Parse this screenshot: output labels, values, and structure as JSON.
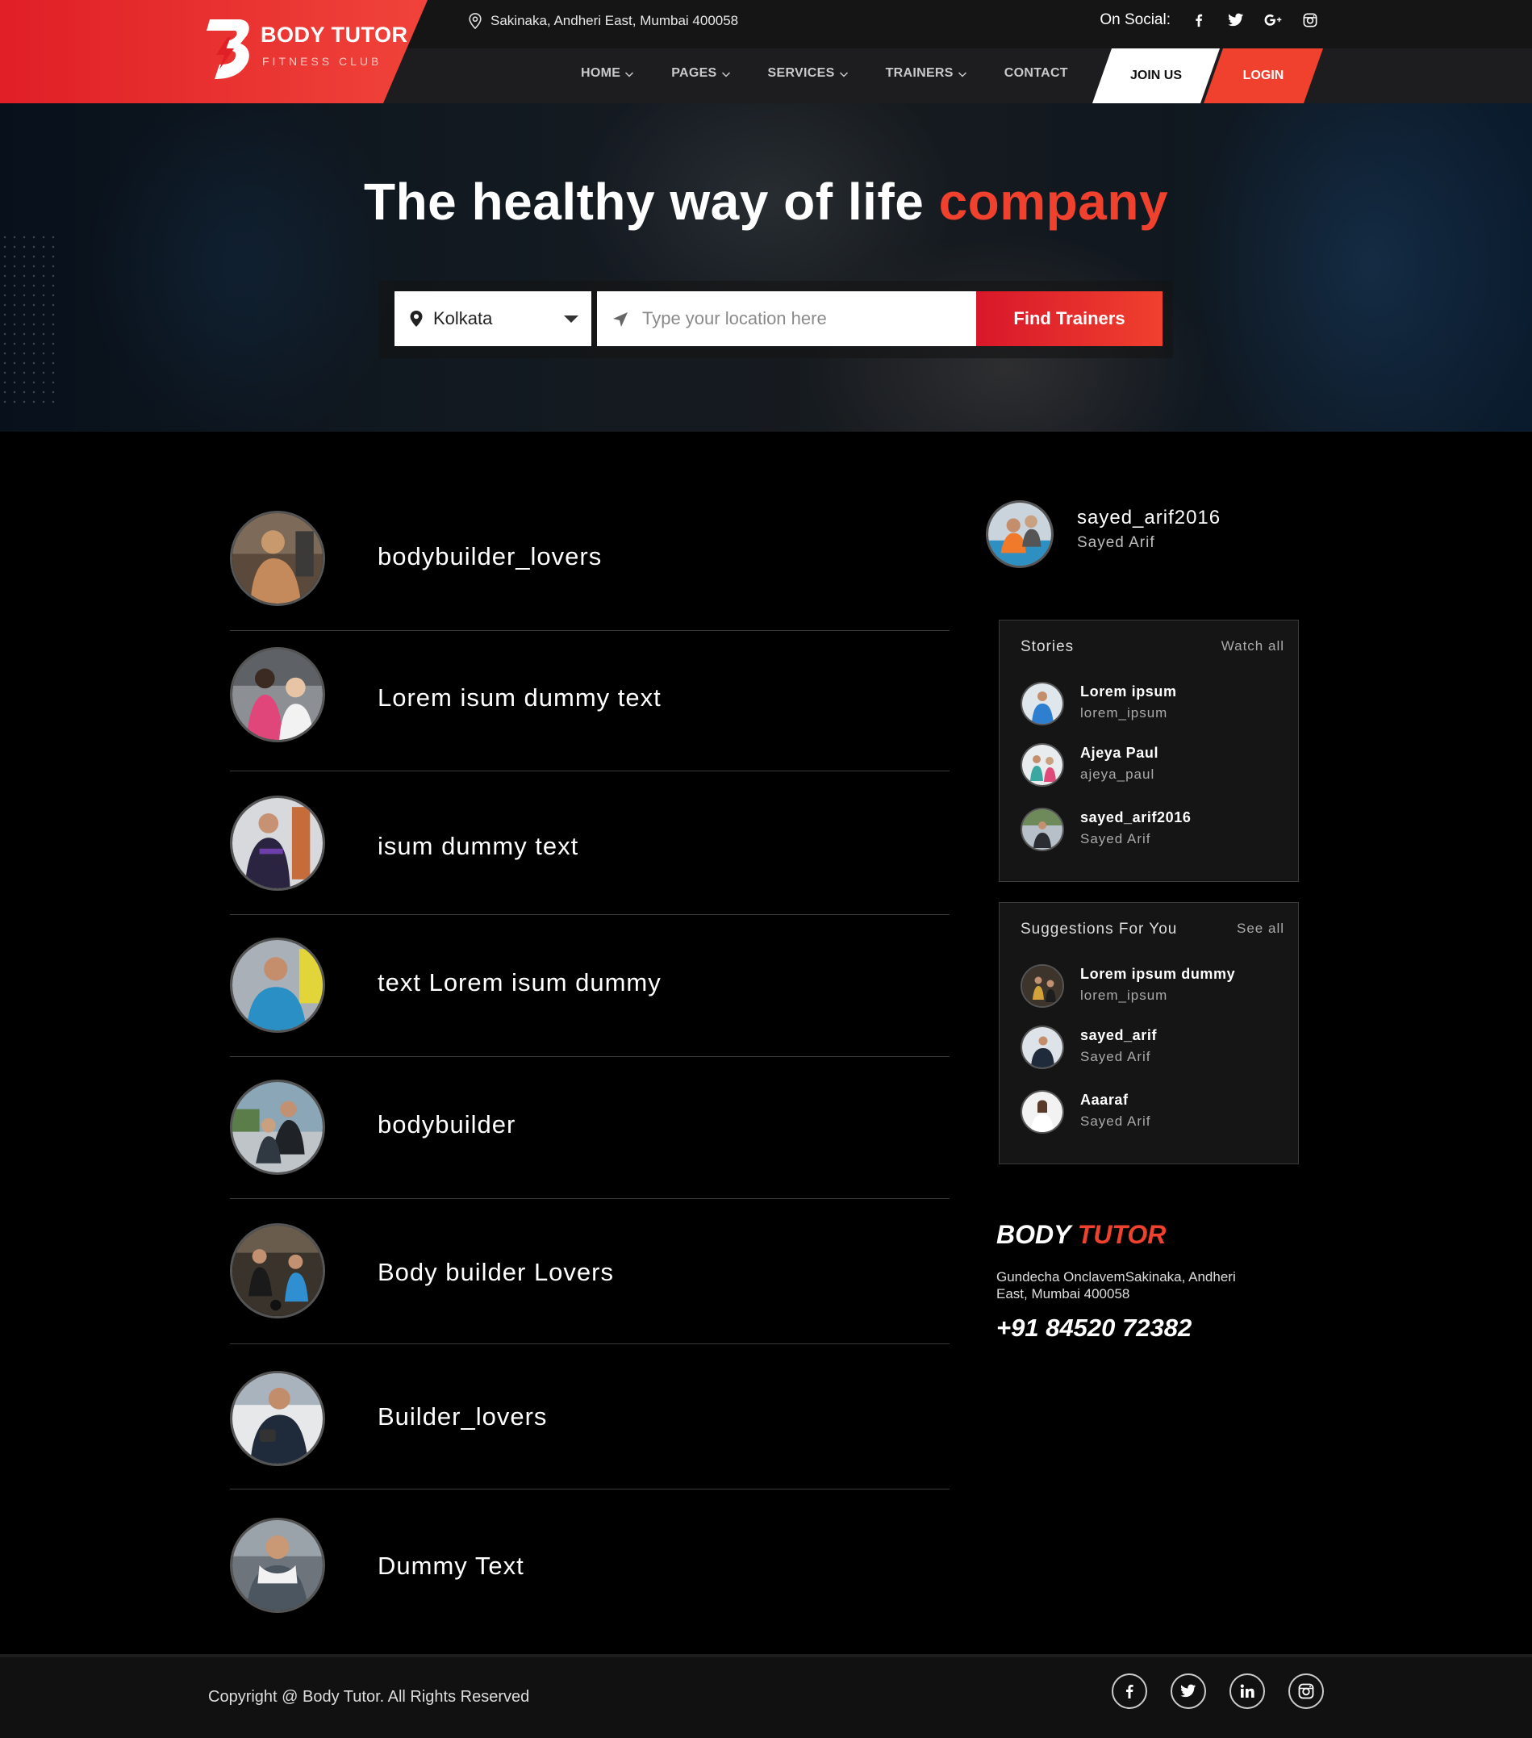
{
  "header": {
    "logo_title": "BODY TUTOR",
    "logo_subtitle": "FITNESS CLUB",
    "address": "Sakinaka, Andheri East, Mumbai 400058",
    "social_label": "On Social:",
    "nav": [
      {
        "label": "HOME",
        "has_dropdown": true
      },
      {
        "label": "PAGES",
        "has_dropdown": true
      },
      {
        "label": "SERVICES",
        "has_dropdown": true
      },
      {
        "label": "TRAINERS",
        "has_dropdown": true
      },
      {
        "label": "CONTACT",
        "has_dropdown": false
      }
    ],
    "join_label": "JOIN US",
    "login_label": "LOGIN",
    "accent_color": "#f0402e"
  },
  "hero": {
    "title_main": "The healthy way of life",
    "title_accent": "company",
    "city": "Kolkata",
    "location_placeholder": "Type your location here",
    "find_label": "Find Trainers"
  },
  "feed": [
    {
      "name": "bodybuilder_lovers"
    },
    {
      "name": "Lorem isum dummy text"
    },
    {
      "name": "isum dummy text"
    },
    {
      "name": " text Lorem isum dummy"
    },
    {
      "name": "bodybuilder"
    },
    {
      "name": "Body builder Lovers"
    },
    {
      "name": "Builder_lovers"
    },
    {
      "name": " Dummy Text"
    }
  ],
  "profile": {
    "username": "sayed_arif2016",
    "fullname": "Sayed Arif"
  },
  "stories": {
    "title": "Stories",
    "link": "Watch all",
    "items": [
      {
        "title": "Lorem ipsum",
        "sub": "lorem_ipsum"
      },
      {
        "title": "Ajeya Paul",
        "sub": "ajeya_paul"
      },
      {
        "title": "sayed_arif2016",
        "sub": "Sayed Arif"
      }
    ]
  },
  "suggestions": {
    "title": "Suggestions For You",
    "link": "See all",
    "items": [
      {
        "title": "Lorem ipsum dummy",
        "sub": "lorem_ipsum"
      },
      {
        "title": "sayed_arif",
        "sub": "Sayed Arif"
      },
      {
        "title": "Aaaraf",
        "sub": "Sayed Arif"
      }
    ]
  },
  "brand": {
    "name_main": "BODY",
    "name_accent": "TUTOR",
    "address": "Gundecha OnclavemSakinaka, Andheri East, Mumbai 400058",
    "phone": "+91 84520 72382"
  },
  "footer": {
    "copyright": "Copyright @ Body Tutor. All Rights Reserved"
  }
}
